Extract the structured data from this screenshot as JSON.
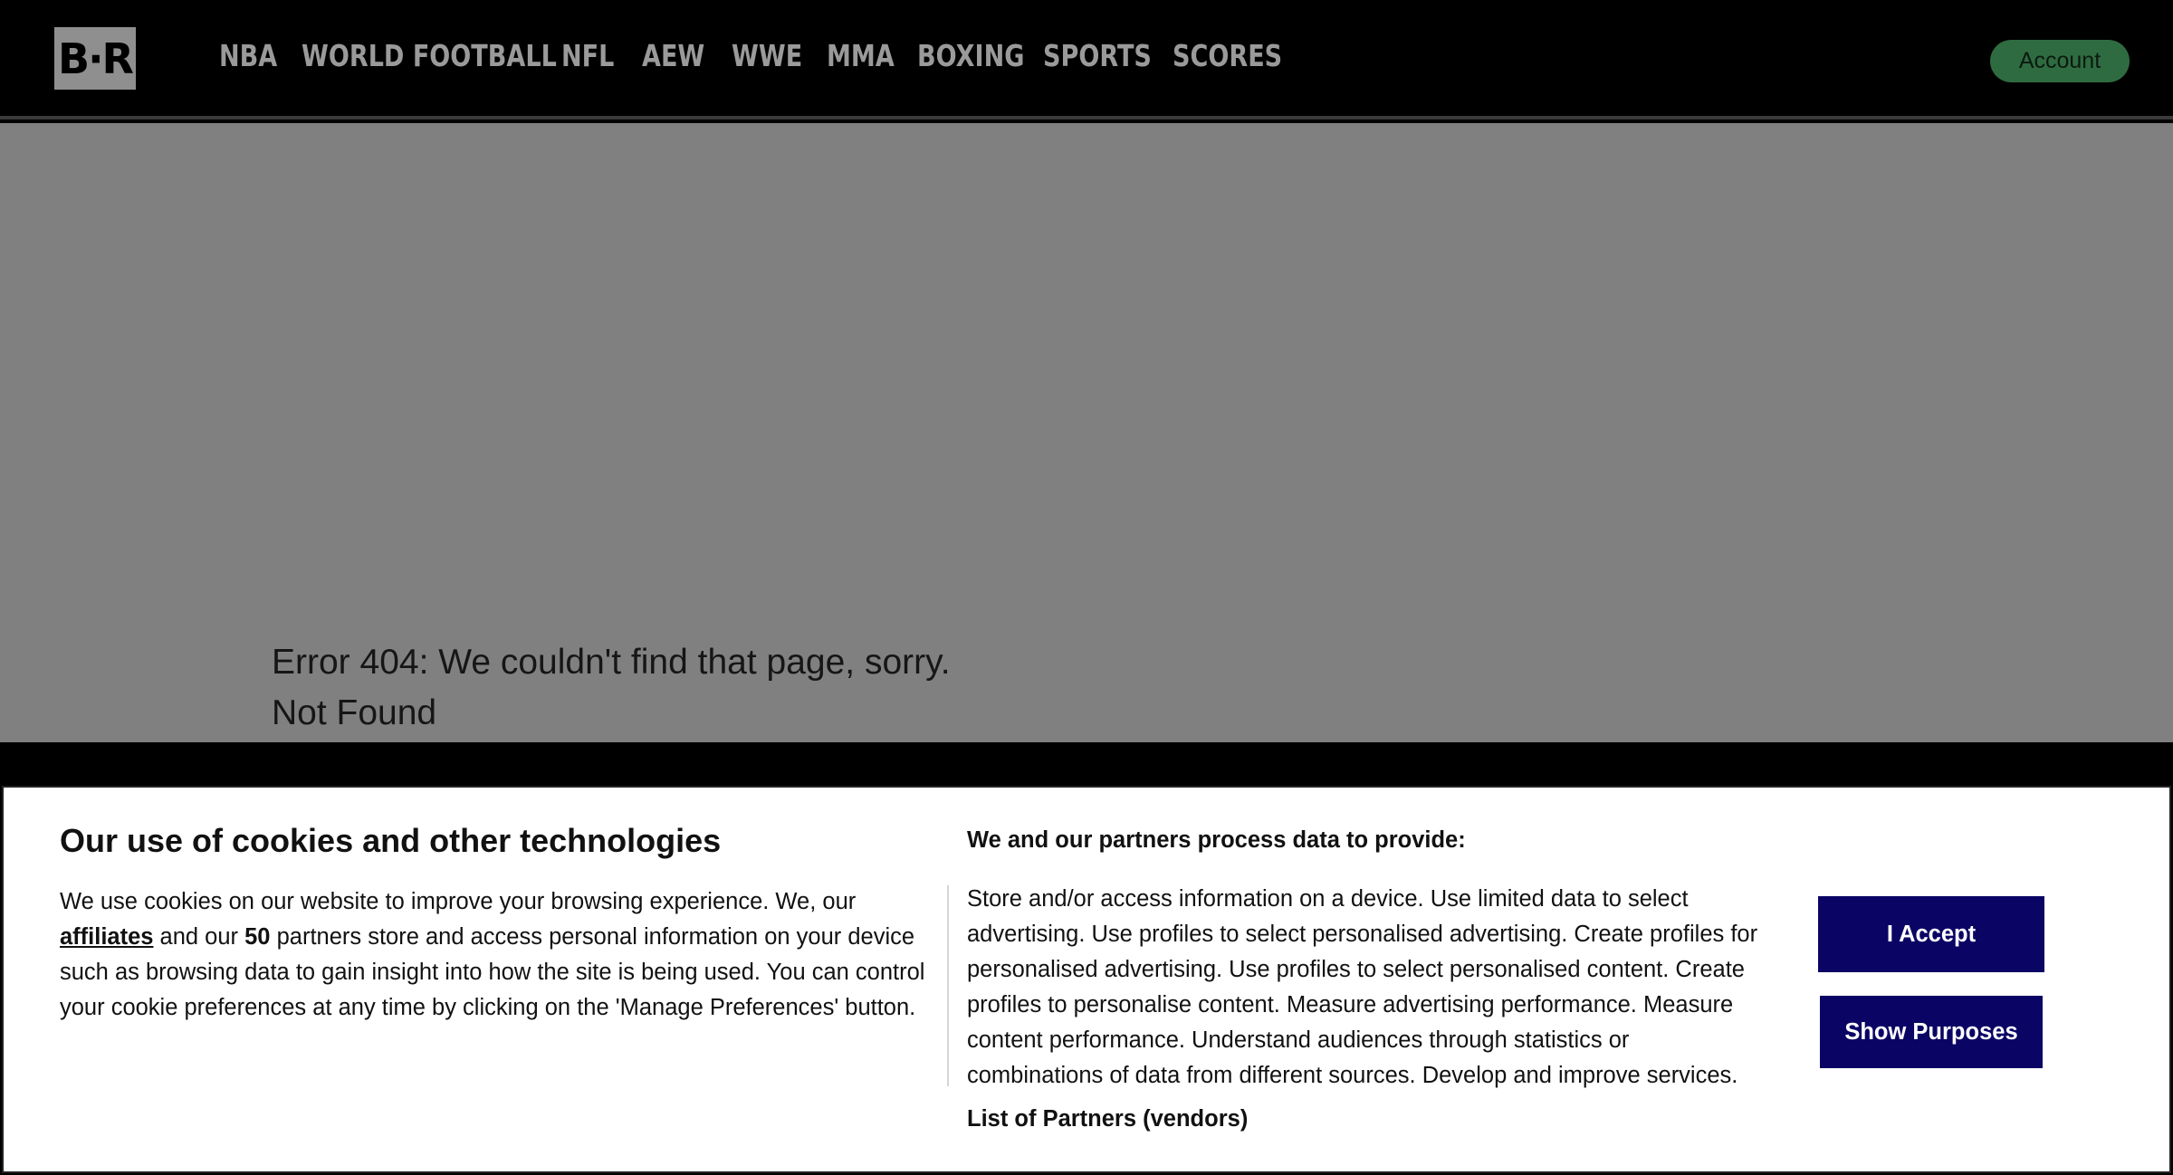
{
  "header": {
    "logo_text": "B·R",
    "nav": [
      "NBA",
      "WORLD FOOTBALL",
      "NFL",
      "AEW",
      "WWE",
      "MMA",
      "BOXING",
      "SPORTS",
      "SCORES"
    ],
    "account_label": "Account"
  },
  "main": {
    "error_message": "Error 404: We couldn't find that page, sorry.",
    "error_status": "Not Found"
  },
  "cookie_banner": {
    "title": "Our use of cookies and other technologies",
    "text_part1": "We use cookies on our website to improve your browsing experience. We, our ",
    "affiliates_link": "affiliates",
    "text_part2": " and our ",
    "partner_count": "50",
    "text_part3": " partners store and access personal information on your device such as browsing data to gain insight into how the site is being used. You can control your cookie preferences at any time by clicking on the 'Manage Preferences' button.",
    "purposes_title": "We and our partners process data to provide:",
    "purposes_text": "Store and/or access information on a device. Use limited data to select advertising. Use profiles to select personalised advertising. Create profiles for personalised advertising. Use profiles to select personalised content. Create profiles to personalise content. Measure advertising performance. Measure content performance. Understand audiences through statistics or combinations of data from different sources. Develop and improve services.",
    "partners_link": "List of Partners (vendors)",
    "accept_label": "I Accept",
    "show_purposes_label": "Show Purposes"
  },
  "colors": {
    "header_bg": "#000000",
    "main_bg": "#808080",
    "nav_text": "#9a9a9a",
    "account_bg": "#2f6b40",
    "button_bg": "#0a0564"
  }
}
